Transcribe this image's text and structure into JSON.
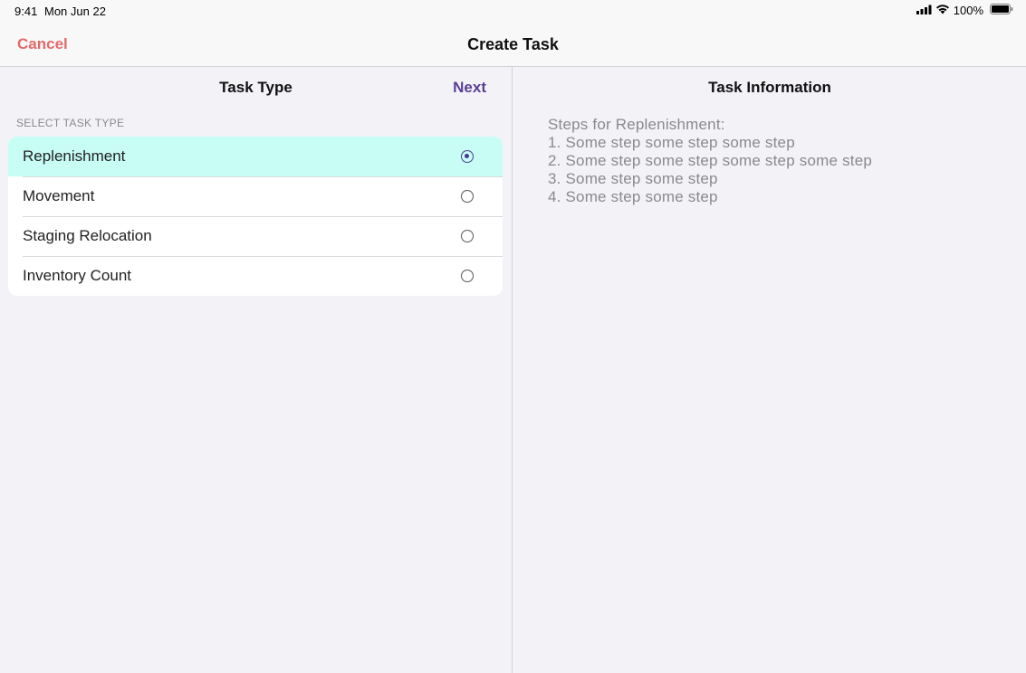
{
  "status_bar": {
    "time": "9:41",
    "date": "Mon Jun 22",
    "battery": "100%"
  },
  "nav": {
    "cancel_label": "Cancel",
    "title": "Create Task"
  },
  "left_pane": {
    "title": "Task Type",
    "next_label": "Next",
    "section_label": "SELECT TASK TYPE",
    "options": [
      {
        "label": "Replenishment",
        "selected": true
      },
      {
        "label": "Movement",
        "selected": false
      },
      {
        "label": "Staging Relocation",
        "selected": false
      },
      {
        "label": "Inventory Count",
        "selected": false
      }
    ]
  },
  "right_pane": {
    "title": "Task Information",
    "steps": [
      "Steps for Replenishment:",
      "1. Some step some step some step",
      "2. Some step some step some step some step",
      "3. Some step some step",
      "4. Some step some step"
    ]
  },
  "colors": {
    "cancel": "#e36a6a",
    "next": "#5a3e96",
    "selected_row": "#c8fdf6",
    "radio_selected": "#4b3b8f"
  }
}
